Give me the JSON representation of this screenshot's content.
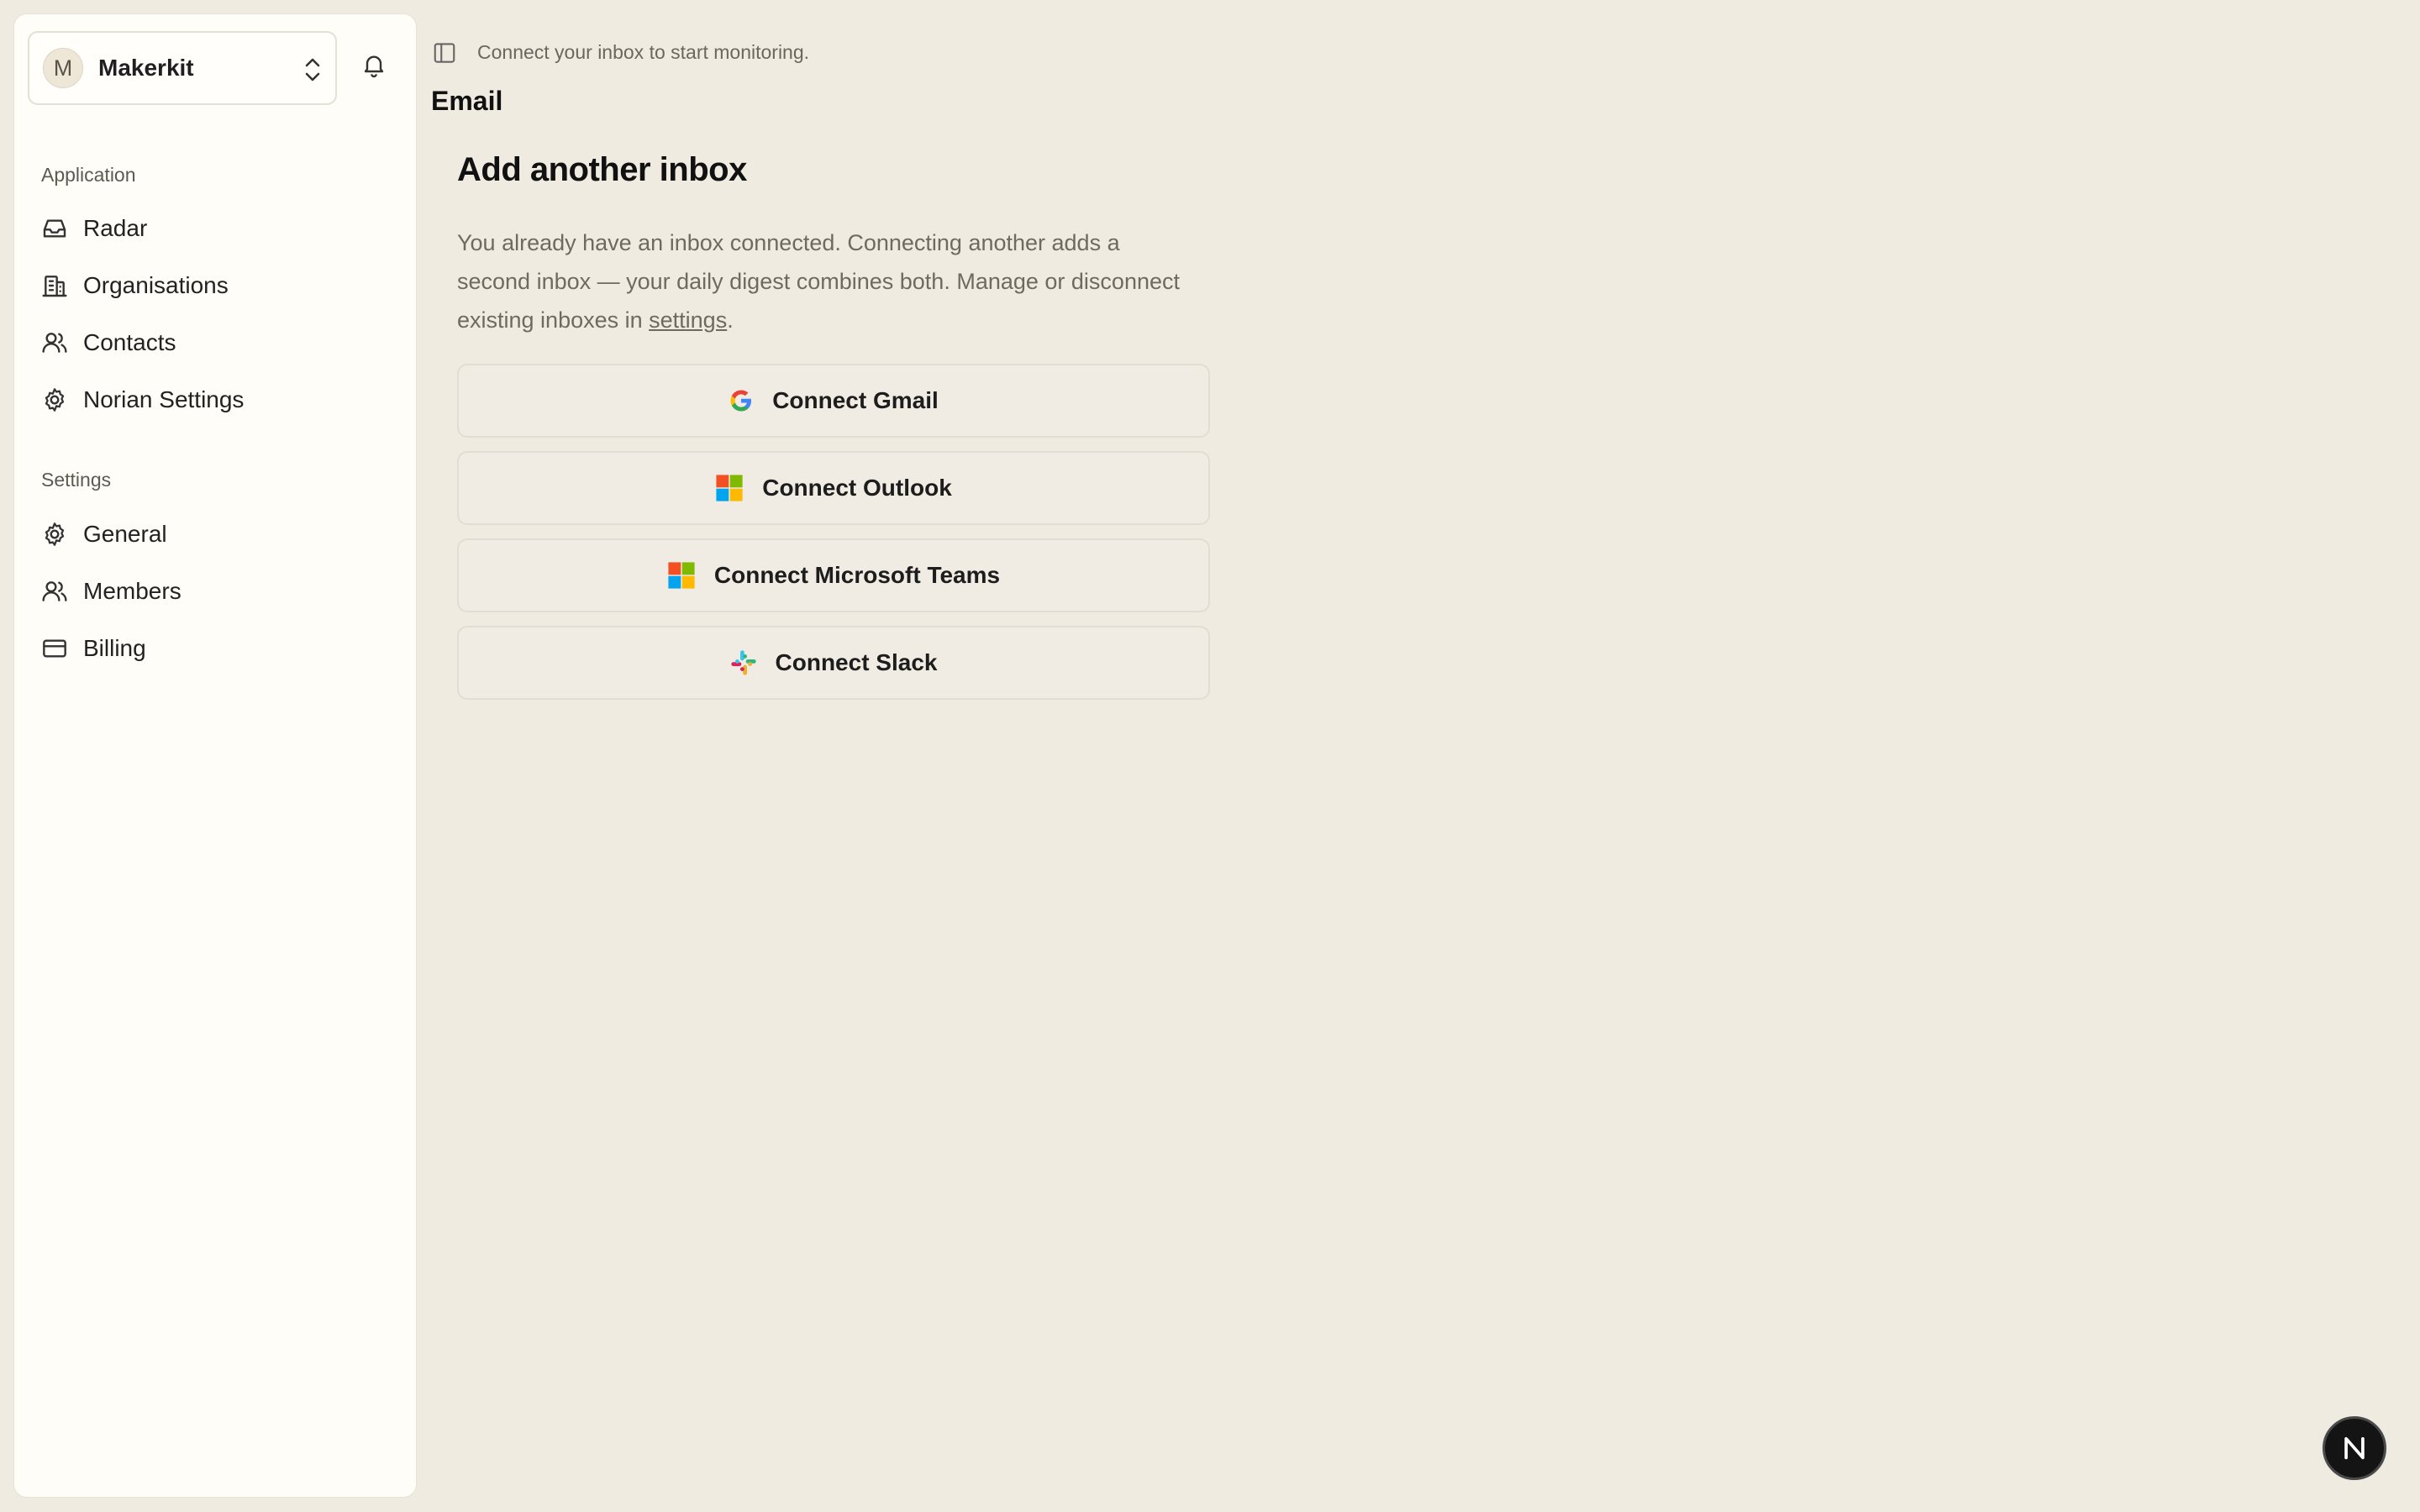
{
  "account": {
    "initial": "M",
    "name": "Makerkit"
  },
  "topbar": {
    "hint": "Connect your inbox to start monitoring."
  },
  "sidebar": {
    "application_label": "Application",
    "application_items": [
      {
        "label": "Radar",
        "icon": "inbox-icon"
      },
      {
        "label": "Organisations",
        "icon": "building-icon"
      },
      {
        "label": "Contacts",
        "icon": "users-icon"
      },
      {
        "label": "Norian Settings",
        "icon": "gear-icon"
      }
    ],
    "settings_label": "Settings",
    "settings_items": [
      {
        "label": "General",
        "icon": "gear-icon"
      },
      {
        "label": "Members",
        "icon": "users-icon"
      },
      {
        "label": "Billing",
        "icon": "credit-card-icon"
      }
    ]
  },
  "main": {
    "page_title": "Email",
    "heading": "Add another inbox",
    "description_before": "You already have an inbox connected. Connecting another adds a second inbox — your daily digest combines both. Manage or disconnect existing inboxes in ",
    "description_link": "settings",
    "description_after": ".",
    "buttons": [
      {
        "label": "Connect Gmail",
        "icon": "google-icon"
      },
      {
        "label": "Connect Outlook",
        "icon": "microsoft-icon"
      },
      {
        "label": "Connect Microsoft Teams",
        "icon": "microsoft-icon"
      },
      {
        "label": "Connect Slack",
        "icon": "slack-icon"
      }
    ]
  },
  "fab": {
    "letter": "N"
  }
}
